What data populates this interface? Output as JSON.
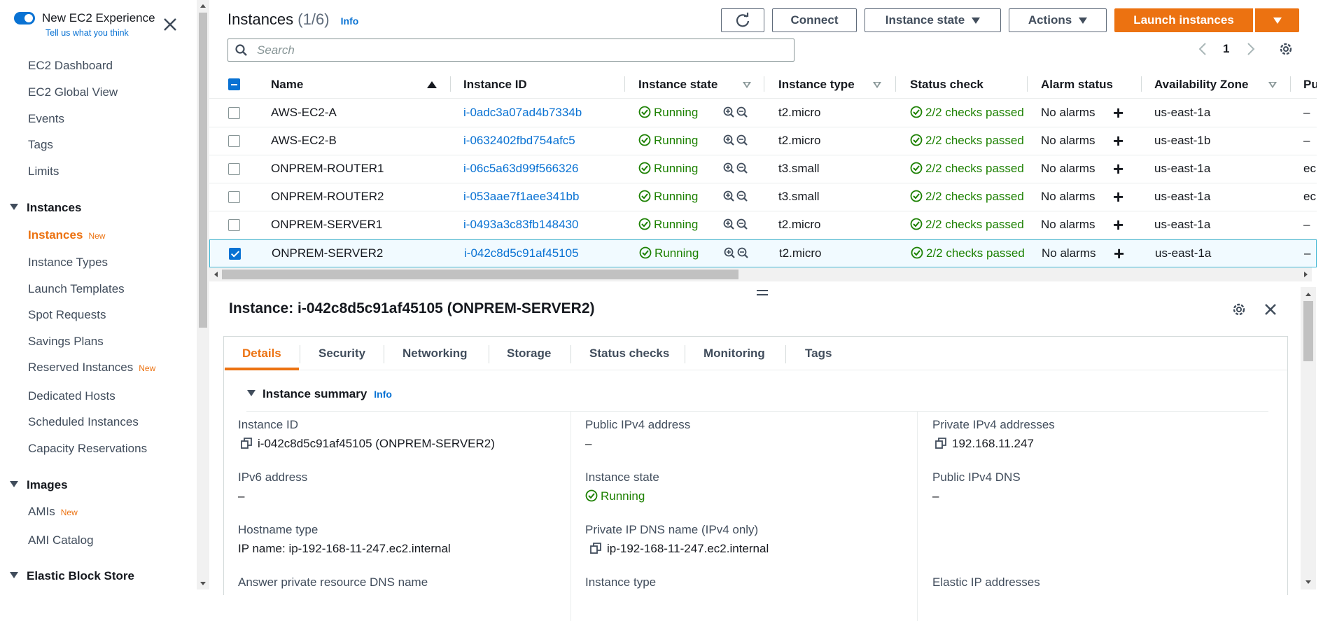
{
  "sidebar": {
    "toggle_title": "New EC2 Experience",
    "toggle_sub": "Tell us what you think",
    "items_top": [
      "EC2 Dashboard",
      "EC2 Global View",
      "Events",
      "Tags",
      "Limits"
    ],
    "instances_section": "Instances",
    "instances_items": [
      {
        "label": "Instances",
        "new": "New"
      },
      {
        "label": "Instance Types",
        "new": ""
      },
      {
        "label": "Launch Templates",
        "new": ""
      },
      {
        "label": "Spot Requests",
        "new": ""
      },
      {
        "label": "Savings Plans",
        "new": ""
      },
      {
        "label": "Reserved Instances",
        "new": "New"
      },
      {
        "label": "Dedicated Hosts",
        "new": ""
      },
      {
        "label": "Scheduled Instances",
        "new": ""
      },
      {
        "label": "Capacity Reservations",
        "new": ""
      }
    ],
    "images_section": "Images",
    "images_items": [
      {
        "label": "AMIs",
        "new": "New"
      },
      {
        "label": "AMI Catalog",
        "new": ""
      }
    ],
    "ebs_section": "Elastic Block Store"
  },
  "header": {
    "title": "Instances",
    "count": "(1/6)",
    "info": "Info",
    "connect": "Connect",
    "instance_state": "Instance state",
    "actions": "Actions",
    "launch": "Launch instances",
    "search_placeholder": "Search",
    "page": "1"
  },
  "table": {
    "columns": [
      "Name",
      "Instance ID",
      "Instance state",
      "Instance type",
      "Status check",
      "Alarm status",
      "Availability Zone",
      "Pu"
    ],
    "rows": [
      {
        "name": "AWS-EC2-A",
        "id": "i-0adc3a07ad4b7334b",
        "state": "Running",
        "type": "t2.micro",
        "status": "2/2 checks passed",
        "alarm": "No alarms",
        "az": "us-east-1a",
        "pub": "–",
        "selected": false
      },
      {
        "name": "AWS-EC2-B",
        "id": "i-0632402fbd754afc5",
        "state": "Running",
        "type": "t2.micro",
        "status": "2/2 checks passed",
        "alarm": "No alarms",
        "az": "us-east-1b",
        "pub": "–",
        "selected": false
      },
      {
        "name": "ONPREM-ROUTER1",
        "id": "i-06c5a63d99f566326",
        "state": "Running",
        "type": "t3.small",
        "status": "2/2 checks passed",
        "alarm": "No alarms",
        "az": "us-east-1a",
        "pub": "ec",
        "selected": false
      },
      {
        "name": "ONPREM-ROUTER2",
        "id": "i-053aae7f1aee341bb",
        "state": "Running",
        "type": "t3.small",
        "status": "2/2 checks passed",
        "alarm": "No alarms",
        "az": "us-east-1a",
        "pub": "ec",
        "selected": false
      },
      {
        "name": "ONPREM-SERVER1",
        "id": "i-0493a3c83fb148430",
        "state": "Running",
        "type": "t2.micro",
        "status": "2/2 checks passed",
        "alarm": "No alarms",
        "az": "us-east-1a",
        "pub": "–",
        "selected": false
      },
      {
        "name": "ONPREM-SERVER2",
        "id": "i-042c8d5c91af45105",
        "state": "Running",
        "type": "t2.micro",
        "status": "2/2 checks passed",
        "alarm": "No alarms",
        "az": "us-east-1a",
        "pub": "–",
        "selected": true
      }
    ]
  },
  "detail": {
    "title": "Instance: i-042c8d5c91af45105 (ONPREM-SERVER2)",
    "tabs": [
      "Details",
      "Security",
      "Networking",
      "Storage",
      "Status checks",
      "Monitoring",
      "Tags"
    ],
    "summary_title": "Instance summary",
    "summary_info": "Info",
    "fields": {
      "instance_id_label": "Instance ID",
      "instance_id_value": "i-042c8d5c91af45105 (ONPREM-SERVER2)",
      "public_ipv4_label": "Public IPv4 address",
      "public_ipv4_value": "–",
      "private_ipv4_label": "Private IPv4 addresses",
      "private_ipv4_value": "192.168.11.247",
      "ipv6_label": "IPv6 address",
      "ipv6_value": "–",
      "instance_state_label": "Instance state",
      "instance_state_value": "Running",
      "public_dns_label": "Public IPv4 DNS",
      "public_dns_value": "–",
      "hostname_type_label": "Hostname type",
      "hostname_type_value": "IP name: ip-192-168-11-247.ec2.internal",
      "private_dns_label": "Private IP DNS name (IPv4 only)",
      "private_dns_value": "ip-192-168-11-247.ec2.internal",
      "answer_dns_label": "Answer private resource DNS name",
      "instance_type_label": "Instance type",
      "elastic_ip_label": "Elastic IP addresses"
    }
  },
  "colors": {
    "accent": "#ec7211",
    "link": "#0972d3",
    "success": "#1d8102"
  }
}
